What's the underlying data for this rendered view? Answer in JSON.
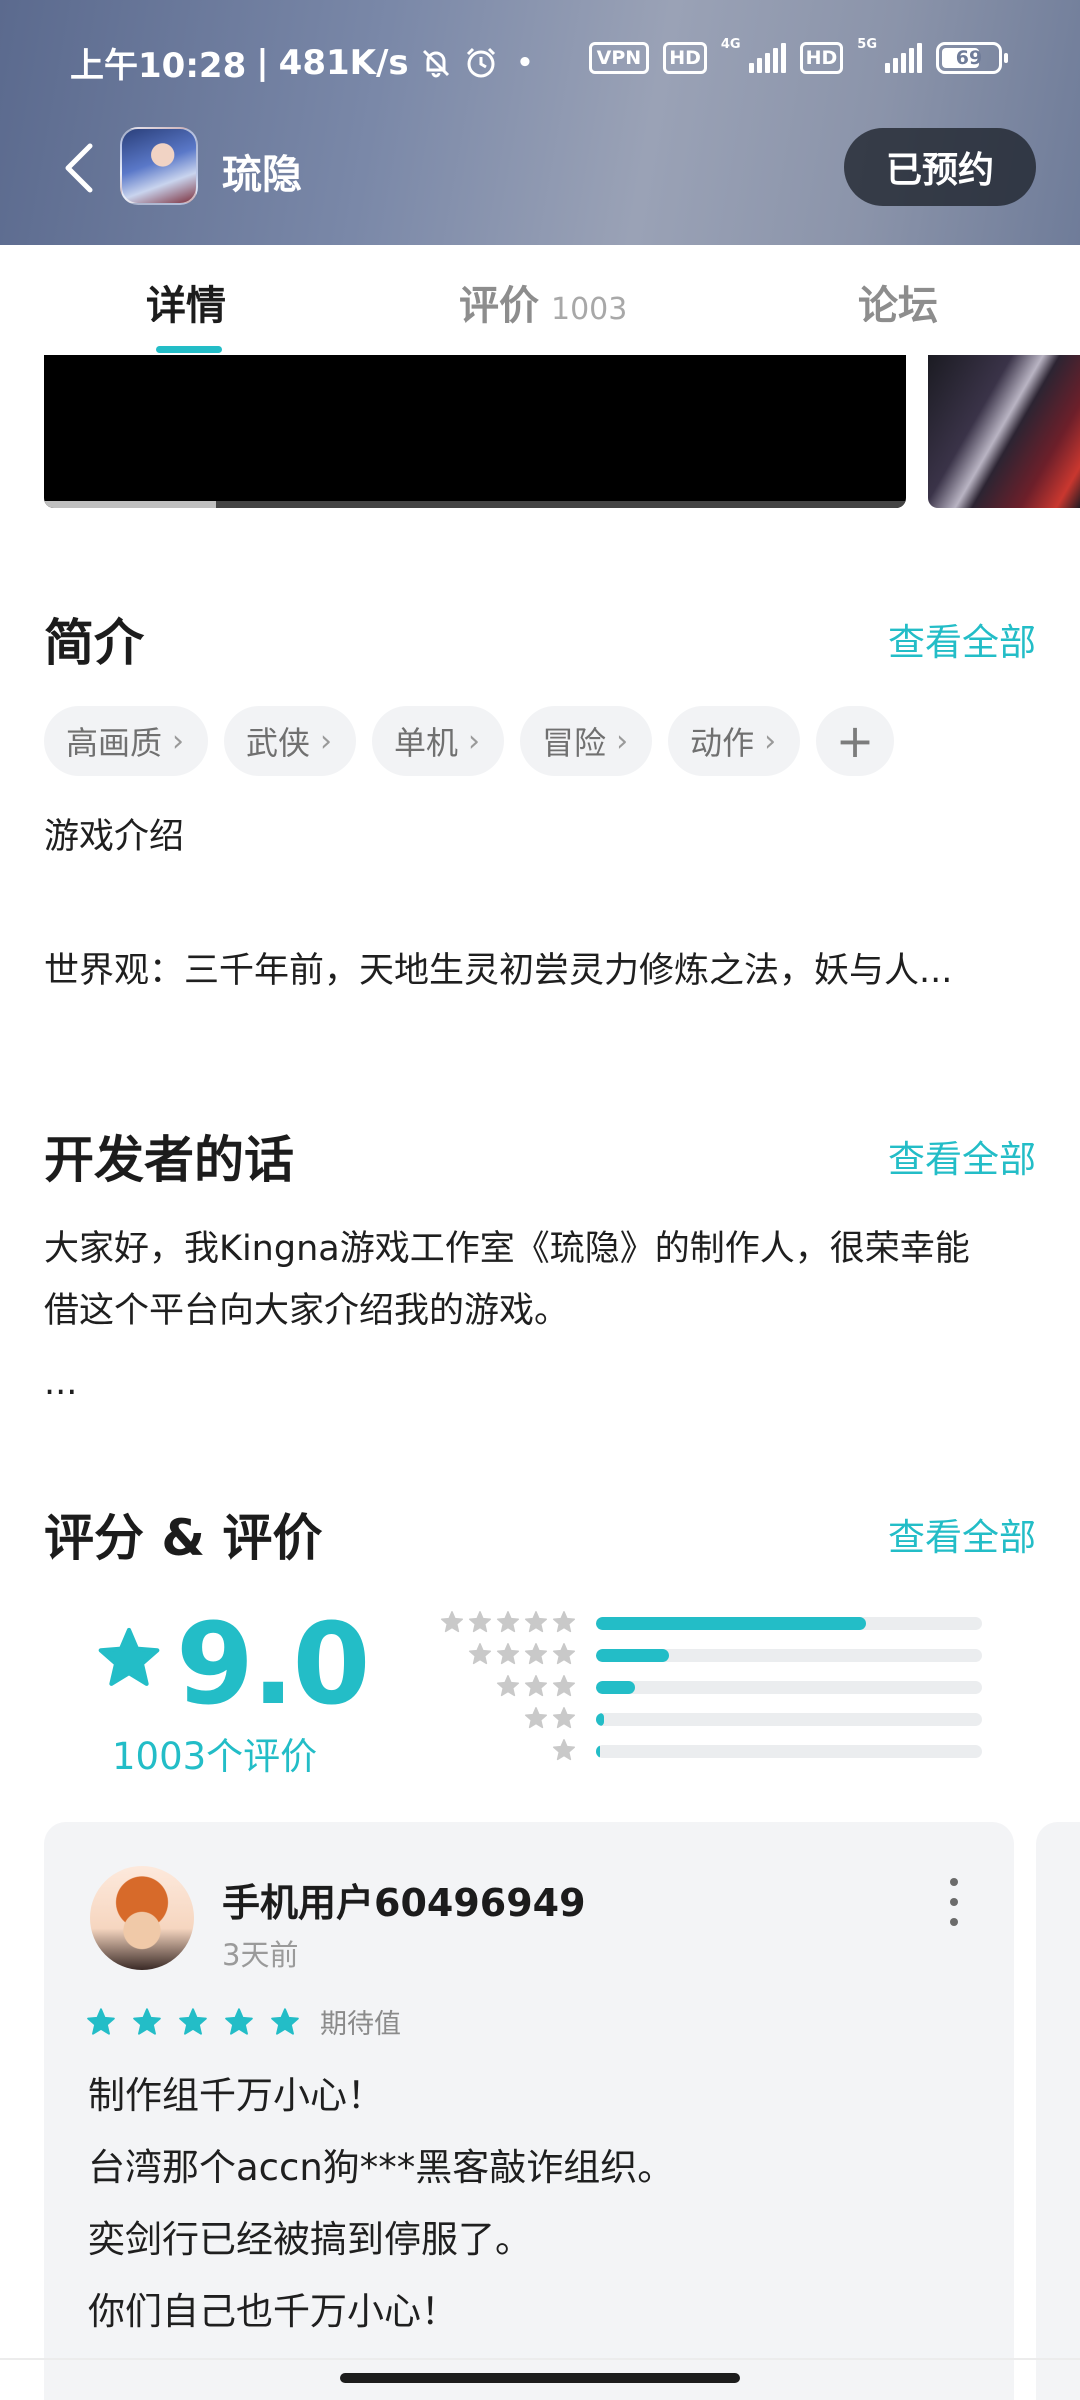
{
  "status_bar": {
    "time": "上午10:28",
    "net_speed": "481K/s",
    "vpn": "VPN",
    "hd1": "HD",
    "net1": "4G",
    "hd2": "HD",
    "net2": "5G",
    "battery": "69",
    "battery_level": 0.69
  },
  "header": {
    "app_name": "琉隐",
    "reserve_label": "已预约"
  },
  "tabs": [
    {
      "label": "详情",
      "active": true
    },
    {
      "label": "评价",
      "count": "1003"
    },
    {
      "label": "论坛"
    }
  ],
  "media": {
    "progress": 0.2
  },
  "intro": {
    "title": "简介",
    "see_all": "查看全部",
    "tags": [
      "高画质",
      "武侠",
      "单机",
      "冒险",
      "动作"
    ],
    "line1": "游戏介绍",
    "line2": "世界观：三千年前，天地生灵初尝灵力修炼之法，妖与人..."
  },
  "developer": {
    "title": "开发者的话",
    "see_all": "查看全部",
    "line1": "大家好，我Kingna游戏工作室《琉隐》的制作人，很荣幸能",
    "line2": "借这个平台向大家介绍我的游戏。",
    "line3": "..."
  },
  "ratings": {
    "title": "评分 & 评价",
    "see_all": "查看全部",
    "score": "9.0",
    "count_text": "1003个评价",
    "distribution": [
      {
        "stars": 5,
        "fraction": 0.7
      },
      {
        "stars": 4,
        "fraction": 0.19
      },
      {
        "stars": 3,
        "fraction": 0.1
      },
      {
        "stars": 2,
        "fraction": 0.02
      },
      {
        "stars": 1,
        "fraction": 0.01
      }
    ],
    "accent": "#23bdc7"
  },
  "review": {
    "user": "手机用户60496949",
    "time": "3天前",
    "stars": 5,
    "tag": "期待值",
    "lines": [
      "制作组千万小心！",
      "台湾那个accn狗***黑客敲诈组织。",
      "奕剑行已经被搞到停服了。",
      "你们自己也千万小心！"
    ]
  }
}
